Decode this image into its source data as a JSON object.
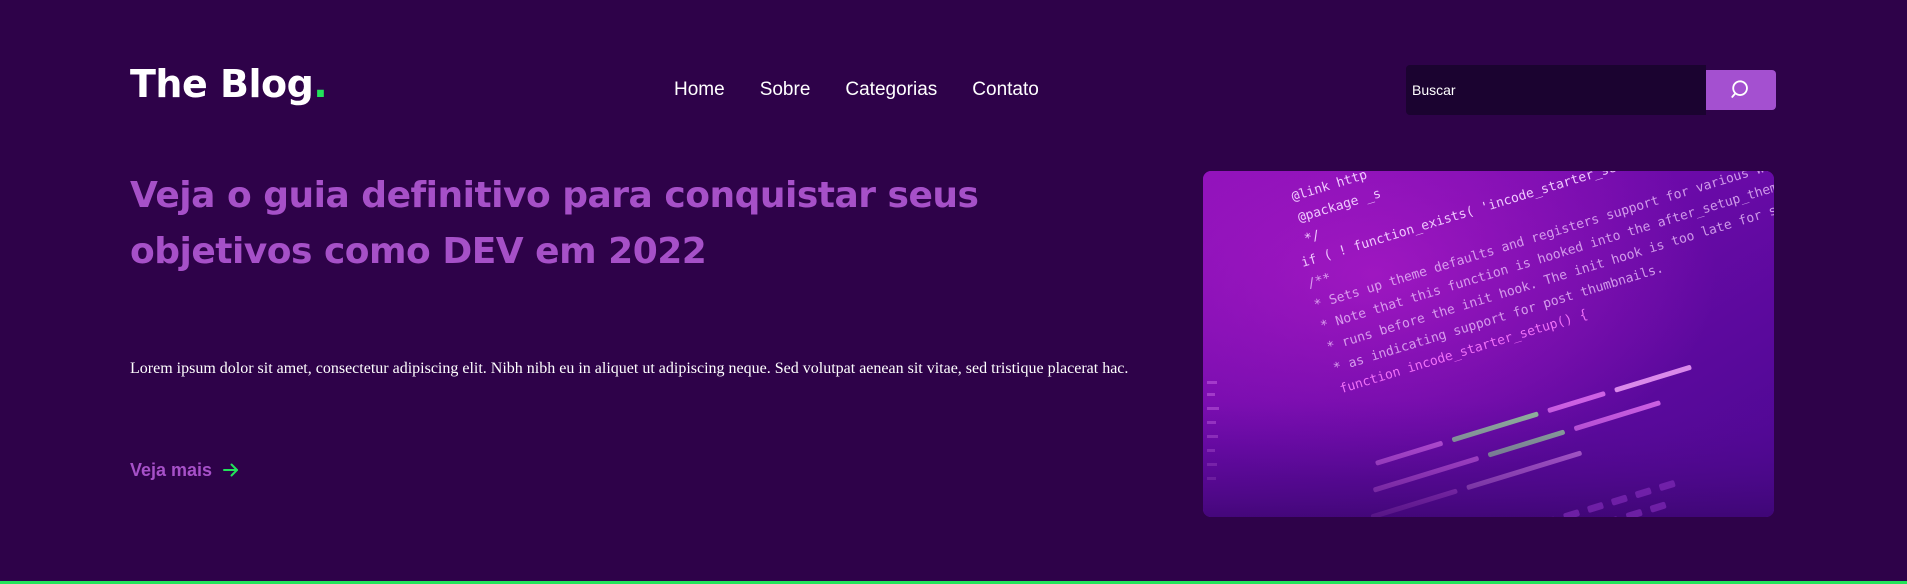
{
  "header": {
    "logo_text": "The Blog",
    "logo_dot": ".",
    "nav": [
      {
        "label": "Home"
      },
      {
        "label": "Sobre"
      },
      {
        "label": "Categorias"
      },
      {
        "label": "Contato"
      }
    ],
    "search": {
      "placeholder": "Buscar",
      "icon": "search-icon"
    }
  },
  "hero": {
    "title": "Veja o guia definitivo para conquistar seus objetivos como DEV em 2022",
    "description": "Lorem ipsum dolor sit amet, consectetur adipiscing elit. Nibh nibh eu in aliquet ut adipiscing neque. Sed volutpat aenean sit vitae, sed tristique placerat hac.",
    "read_more_label": "Veja mais",
    "read_more_icon": "arrow-right-icon",
    "image": {
      "code_lines": [
        "@link http",
        "@package _s",
        "*/",
        "if ( ! function_exists( 'incode_starter_setup' ) ) :",
        "/**",
        " * Sets up theme defaults and registers support for various WordPress features.",
        " * Note that this function is hooked into the after_setup_theme hook, which",
        " * runs before the init hook. The init hook is too late for some features, such",
        " * as indicating support for post thumbnails.",
        "function incode_starter_setup() {"
      ]
    }
  },
  "colors": {
    "background": "#2e0249",
    "accent": "#a650c8",
    "green": "#22e35a",
    "search_button": "#a450d0"
  }
}
